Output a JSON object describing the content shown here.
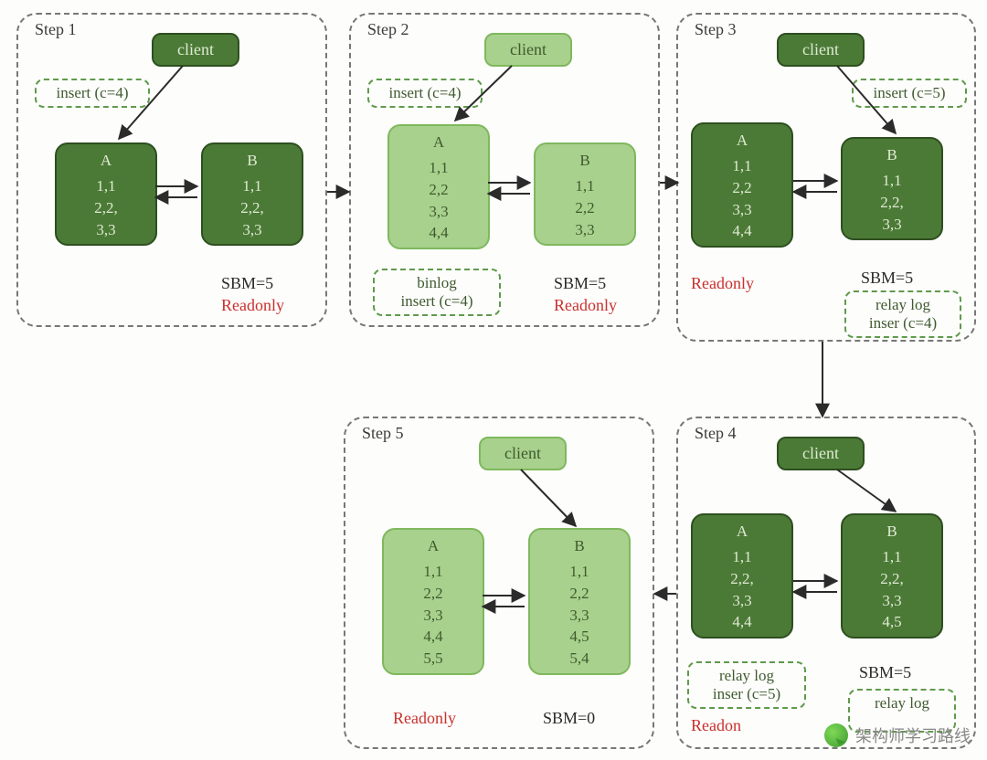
{
  "colors": {
    "dark": "#4b7a36",
    "light": "#a8d18d",
    "red": "#c9302c",
    "dash": "#777"
  },
  "steps": [
    {
      "id": "s1",
      "title": "Step 1",
      "client": {
        "label": "client",
        "tone": "dark"
      },
      "insert": "insert (c=4)",
      "A": {
        "name": "A",
        "rows": [
          "1,1",
          "2,2,",
          "3,3"
        ],
        "tone": "dark"
      },
      "B": {
        "name": "B",
        "rows": [
          "1,1",
          "2,2,",
          "3,3"
        ],
        "tone": "dark"
      },
      "sbm": "SBM=5",
      "readonly": "Readonly",
      "readonly_side": "B",
      "binlog": null,
      "relay": null
    },
    {
      "id": "s2",
      "title": "Step 2",
      "client": {
        "label": "client",
        "tone": "light"
      },
      "insert": "insert (c=4)",
      "A": {
        "name": "A",
        "rows": [
          "1,1",
          "2,2",
          "3,3",
          "4,4"
        ],
        "tone": "light"
      },
      "B": {
        "name": "B",
        "rows": [
          "1,1",
          "2,2",
          "3,3"
        ],
        "tone": "light"
      },
      "sbm": "SBM=5",
      "readonly": "Readonly",
      "readonly_side": "B",
      "binlog": {
        "line1": "binlog",
        "line2": "insert (c=4)"
      },
      "relay": null
    },
    {
      "id": "s3",
      "title": "Step 3",
      "client": {
        "label": "client",
        "tone": "dark"
      },
      "insert": "insert (c=5)",
      "A": {
        "name": "A",
        "rows": [
          "1,1",
          "2,2",
          "3,3",
          "4,4"
        ],
        "tone": "dark"
      },
      "B": {
        "name": "B",
        "rows": [
          "1,1",
          "2,2,",
          "3,3"
        ],
        "tone": "dark"
      },
      "sbm": "SBM=5",
      "readonly": "Readonly",
      "readonly_side": "A",
      "binlog": null,
      "relay": {
        "line1": "relay log",
        "line2": "inser (c=4)"
      }
    },
    {
      "id": "s4",
      "title": "Step 4",
      "client": {
        "label": "client",
        "tone": "dark"
      },
      "insert": null,
      "A": {
        "name": "A",
        "rows": [
          "1,1",
          "2,2,",
          "3,3",
          "4,4"
        ],
        "tone": "dark"
      },
      "B": {
        "name": "B",
        "rows": [
          "1,1",
          "2,2,",
          "3,3",
          "4,5"
        ],
        "tone": "dark"
      },
      "sbm": "SBM=5",
      "readonly": "Readon",
      "readonly_side": "A",
      "binlog": null,
      "relayA": {
        "line1": "relay log",
        "line2": "inser (c=5)"
      },
      "relayB": {
        "line1": "relay log",
        "line2": ""
      }
    },
    {
      "id": "s5",
      "title": "Step 5",
      "client": {
        "label": "client",
        "tone": "light"
      },
      "insert": null,
      "A": {
        "name": "A",
        "rows": [
          "1,1",
          "2,2",
          "3,3",
          "4,4",
          "5,5"
        ],
        "tone": "light"
      },
      "B": {
        "name": "B",
        "rows": [
          "1,1",
          "2,2",
          "3,3",
          "4,5",
          "5,4"
        ],
        "tone": "light"
      },
      "sbm": "SBM=0",
      "readonly": "Readonly",
      "readonly_side": "A",
      "binlog": null,
      "relay": null
    }
  ],
  "watermark": "架构师学习路线"
}
